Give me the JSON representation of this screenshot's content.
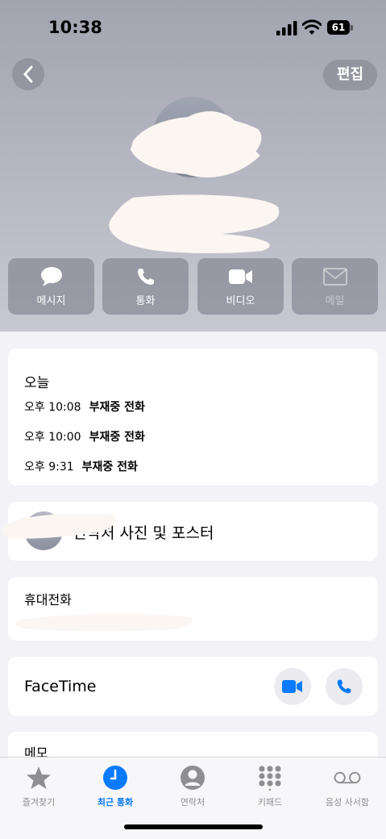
{
  "status_bar": {
    "time": "10:38",
    "battery": "61"
  },
  "header": {
    "edit_label": "편집"
  },
  "actions": [
    {
      "label": "메시지",
      "icon": "message-bubble-icon",
      "enabled": true
    },
    {
      "label": "통화",
      "icon": "phone-icon",
      "enabled": true
    },
    {
      "label": "비디오",
      "icon": "video-camera-icon",
      "enabled": true
    },
    {
      "label": "메일",
      "icon": "envelope-icon",
      "enabled": false
    }
  ],
  "recents": {
    "title": "오늘",
    "calls": [
      {
        "time": "오후 10:08",
        "type": "부재중 전화"
      },
      {
        "time": "오후 10:00",
        "type": "부재중 전화"
      },
      {
        "time": "오후 9:31",
        "type": "부재중 전화"
      }
    ]
  },
  "poster": {
    "label": "연락처 사진 및 포스터"
  },
  "phone": {
    "label": "휴대전화"
  },
  "facetime": {
    "label": "FaceTime"
  },
  "memo": {
    "label": "메모"
  },
  "tabs": [
    {
      "label": "즐겨찾기",
      "icon": "star-icon",
      "active": false
    },
    {
      "label": "최근 통화",
      "icon": "clock-icon",
      "active": true
    },
    {
      "label": "연락처",
      "icon": "person-icon",
      "active": false
    },
    {
      "label": "키패드",
      "icon": "keypad-icon",
      "active": false
    },
    {
      "label": "음성 사서함",
      "icon": "voicemail-icon",
      "active": false
    }
  ],
  "colors": {
    "accent": "#0a7aff",
    "header_gray": "#b3b4bf",
    "background": "#f2f2f7"
  }
}
